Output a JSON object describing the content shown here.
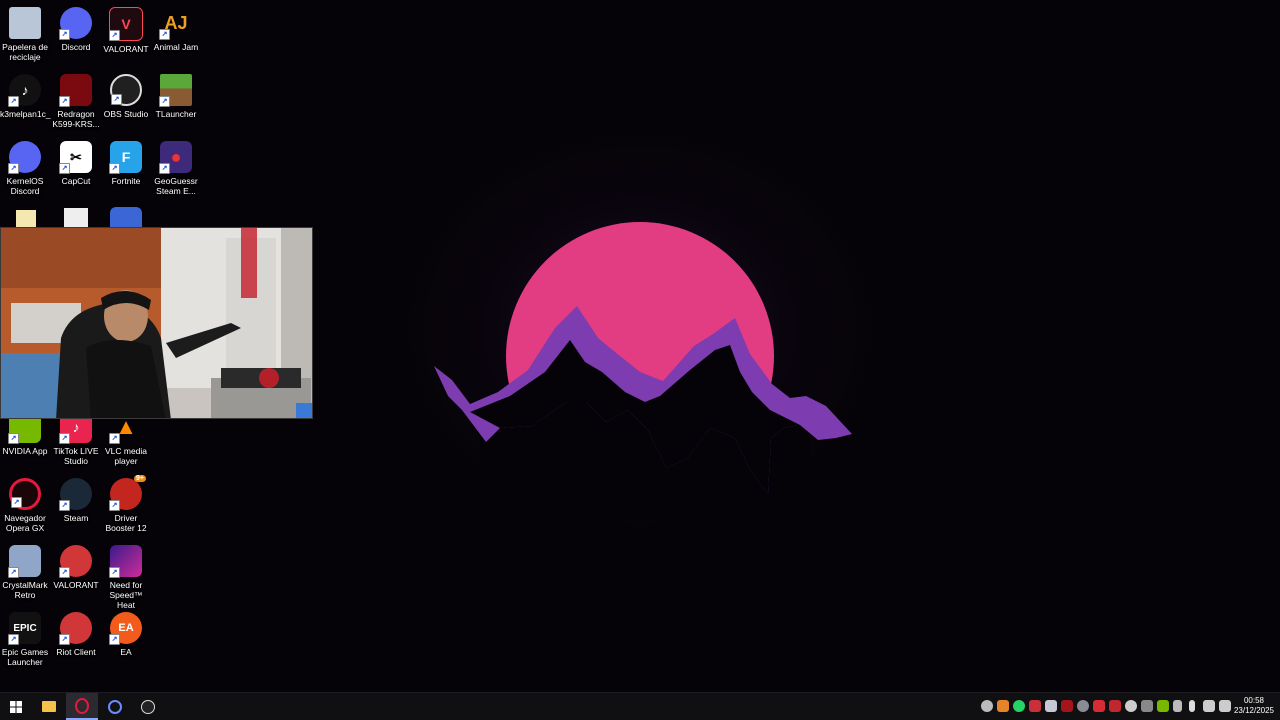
{
  "desktop": {
    "icons": [
      {
        "id": "recycle",
        "label": "Papelera de reciclaje"
      },
      {
        "id": "discord",
        "label": "Discord"
      },
      {
        "id": "valorant1",
        "label": "VALORANT"
      },
      {
        "id": "animaljam",
        "label": "Animal Jam"
      },
      {
        "id": "tiktok",
        "label": "k3melpan1c_"
      },
      {
        "id": "redragon",
        "label": "Redragon K599-KRS..."
      },
      {
        "id": "obs",
        "label": "OBS Studio"
      },
      {
        "id": "tlauncher",
        "label": "TLauncher"
      },
      {
        "id": "kernelos",
        "label": "KernelOS Discord"
      },
      {
        "id": "capcut",
        "label": "CapCut"
      },
      {
        "id": "fortnite",
        "label": "Fortnite"
      },
      {
        "id": "geoguessr",
        "label": "GeoGuessr Steam E..."
      },
      {
        "id": "nvidia",
        "label": "NVIDIA App"
      },
      {
        "id": "tiktoklive",
        "label": "TikTok LIVE Studio"
      },
      {
        "id": "vlc",
        "label": "VLC media player"
      },
      {
        "id": "opera",
        "label": "Navegador Opera GX"
      },
      {
        "id": "steam",
        "label": "Steam"
      },
      {
        "id": "driverbooster",
        "label": "Driver Booster 12"
      },
      {
        "id": "crystalmark",
        "label": "CrystalMark Retro"
      },
      {
        "id": "valorant2",
        "label": "VALORANT"
      },
      {
        "id": "nfs",
        "label": "Need for Speed™ Heat"
      },
      {
        "id": "epic",
        "label": "Epic Games Launcher"
      },
      {
        "id": "riot",
        "label": "Riot Client"
      },
      {
        "id": "ea",
        "label": "EA"
      }
    ],
    "fortnite_glyph": "F",
    "epic_glyph": "EPIC",
    "ea_glyph": "EA",
    "driver_badge": "9+"
  },
  "taskbar": {
    "clock_time": "00:58",
    "clock_date": "23/12/2025"
  },
  "colors": {
    "sun": "#e23c83",
    "mountain": "#7d3cb0",
    "taskbar": "#101012"
  }
}
